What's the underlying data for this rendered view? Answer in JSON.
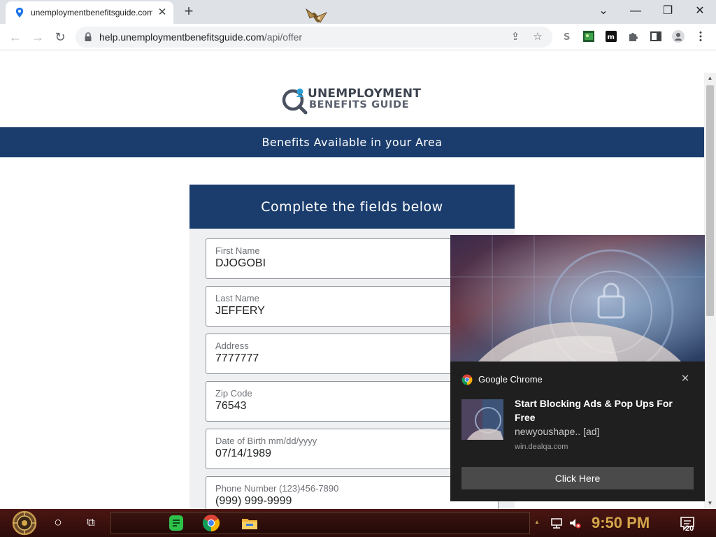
{
  "browser": {
    "tab": {
      "title": "unemploymentbenefitsguide.com"
    },
    "url": {
      "host": "help.unemploymentbenefitsguide.com",
      "path": "/api/offer"
    }
  },
  "page": {
    "logo": {
      "line1": "UNEMPLOYMENT",
      "line2": "BENEFITS GUIDE"
    },
    "banner": "Benefits Available in your Area",
    "form": {
      "heading": "Complete the fields below",
      "fields": [
        {
          "label": "First Name",
          "value": "DJOGOBI"
        },
        {
          "label": "Last Name",
          "value": "JEFFERY"
        },
        {
          "label": "Address",
          "value": "7777777"
        },
        {
          "label": "Zip Code",
          "value": "76543"
        },
        {
          "label": "Date of Birth mm/dd/yyyy",
          "value": "07/14/1989"
        },
        {
          "label": "Phone Number (123)456-7890",
          "value": "(999) 999-9999"
        }
      ]
    }
  },
  "notification": {
    "app": "Google Chrome",
    "title": "Start Blocking Ads & Pop Ups For Free",
    "body": "newyoushape.. [ad]",
    "source": "win.dealqa.com",
    "action": "Click Here"
  },
  "taskbar": {
    "clock": "9:50 PM",
    "notification_count": "20"
  },
  "colors": {
    "brand_navy": "#1b3d6d",
    "logo_accent": "#2a9fd6",
    "taskbar": "#3a100d",
    "clock": "#d4a64a"
  }
}
